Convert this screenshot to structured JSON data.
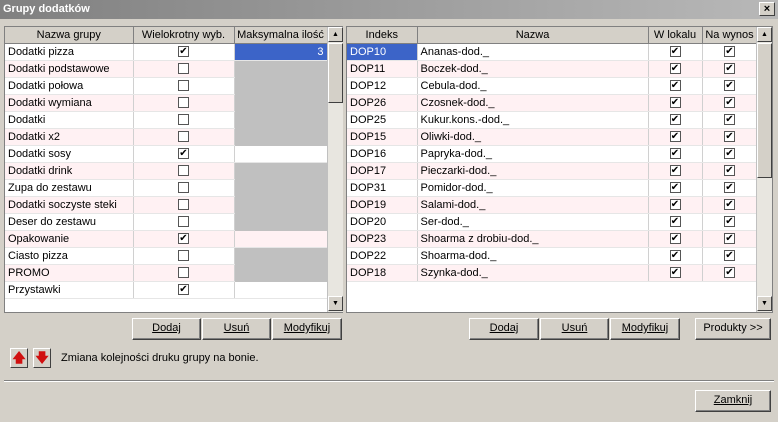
{
  "window": {
    "title": "Grupy dodatków",
    "close_label": "×"
  },
  "groups": {
    "columns": [
      "Nazwa grupy",
      "Wielokrotny wyb.",
      "Maksymalna ilość"
    ],
    "rows": [
      {
        "name": "Dodatki pizza",
        "multi": true,
        "max": "3",
        "state": "selected"
      },
      {
        "name": "Dodatki podstawowe",
        "multi": false,
        "max": "",
        "state": "gray"
      },
      {
        "name": "Dodatki połowa",
        "multi": false,
        "max": "",
        "state": "gray"
      },
      {
        "name": "Dodatki wymiana",
        "multi": false,
        "max": "",
        "state": "gray"
      },
      {
        "name": "Dodatki",
        "multi": false,
        "max": "",
        "state": "gray"
      },
      {
        "name": "Dodatki x2",
        "multi": false,
        "max": "",
        "state": "gray"
      },
      {
        "name": "Dodatki sosy",
        "multi": true,
        "max": "",
        "state": "white"
      },
      {
        "name": "Dodatki drink",
        "multi": false,
        "max": "",
        "state": "gray"
      },
      {
        "name": "Zupa do zestawu",
        "multi": false,
        "max": "",
        "state": "gray"
      },
      {
        "name": "Dodatki soczyste steki",
        "multi": false,
        "max": "",
        "state": "gray"
      },
      {
        "name": "Deser do zestawu",
        "multi": false,
        "max": "",
        "state": "gray"
      },
      {
        "name": "Opakowanie",
        "multi": true,
        "max": "",
        "state": "white"
      },
      {
        "name": "Ciasto pizza",
        "multi": false,
        "max": "",
        "state": "gray"
      },
      {
        "name": "PROMO",
        "multi": false,
        "max": "",
        "state": "gray"
      },
      {
        "name": "Przystawki",
        "multi": true,
        "max": "",
        "state": "white"
      }
    ]
  },
  "items": {
    "columns": [
      "Indeks",
      "Nazwa",
      "W lokalu",
      "Na wynos"
    ],
    "rows": [
      {
        "index": "DOP10",
        "name": "Ananas-dod._",
        "local": true,
        "takeaway": true
      },
      {
        "index": "DOP11",
        "name": "Boczek-dod._",
        "local": true,
        "takeaway": true
      },
      {
        "index": "DOP12",
        "name": "Cebula-dod._",
        "local": true,
        "takeaway": true
      },
      {
        "index": "DOP26",
        "name": "Czosnek-dod._",
        "local": true,
        "takeaway": true
      },
      {
        "index": "DOP25",
        "name": "Kukur.kons.-dod._",
        "local": true,
        "takeaway": true
      },
      {
        "index": "DOP15",
        "name": "Oliwki-dod._",
        "local": true,
        "takeaway": true
      },
      {
        "index": "DOP16",
        "name": "Papryka-dod._",
        "local": true,
        "takeaway": true
      },
      {
        "index": "DOP17",
        "name": "Pieczarki-dod._",
        "local": true,
        "takeaway": true
      },
      {
        "index": "DOP31",
        "name": "Pomidor-dod._",
        "local": true,
        "takeaway": true
      },
      {
        "index": "DOP19",
        "name": "Salami-dod._",
        "local": true,
        "takeaway": true
      },
      {
        "index": "DOP20",
        "name": "Ser-dod._",
        "local": true,
        "takeaway": true
      },
      {
        "index": "DOP23",
        "name": "Shoarma z drobiu-dod._",
        "local": true,
        "takeaway": true
      },
      {
        "index": "DOP22",
        "name": "Shoarma-dod._",
        "local": true,
        "takeaway": true
      },
      {
        "index": "DOP18",
        "name": "Szynka-dod._",
        "local": true,
        "takeaway": true
      }
    ]
  },
  "buttons": {
    "add": "Dodaj",
    "remove": "Usuń",
    "modify": "Modyfikuj",
    "products": "Produkty >>",
    "close": "Zamknij",
    "up": "🡅",
    "down": "🡇"
  },
  "info_text": "Zmiana kolejności druku grupy na bonie.",
  "check_glyph": "✔"
}
